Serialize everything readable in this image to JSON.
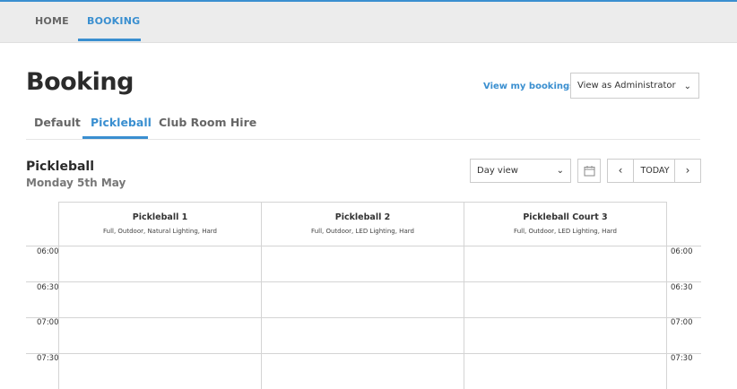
{
  "nav": {
    "home": "HOME",
    "booking": "BOOKING"
  },
  "page": {
    "title": "Booking"
  },
  "header": {
    "my_bookings": "View my bookings >",
    "view_as": "View as Administrator"
  },
  "tabs": [
    "Default",
    "Pickleball",
    "Club Room Hire"
  ],
  "section": {
    "title": "Pickleball",
    "date": "Monday 5th May"
  },
  "controls": {
    "view_select": "Day view",
    "prev": "‹",
    "today": "TODAY",
    "next": "›"
  },
  "courts": [
    {
      "name": "Pickleball 1",
      "desc": "Full, Outdoor, Natural Lighting, Hard"
    },
    {
      "name": "Pickleball 2",
      "desc": "Full, Outdoor, LED Lighting, Hard"
    },
    {
      "name": "Pickleball Court 3",
      "desc": "Full, Outdoor, LED Lighting, Hard"
    }
  ],
  "times": [
    "06:00",
    "06:30",
    "07:00",
    "07:30"
  ],
  "colors": {
    "accent": "#3a8fd0",
    "nav_bg": "#ececec"
  }
}
